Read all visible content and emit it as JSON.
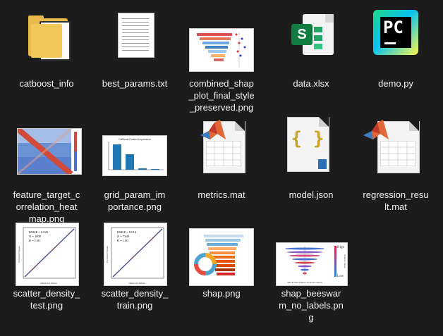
{
  "files": [
    {
      "label": "catboost_info",
      "icon": "folder-icon"
    },
    {
      "label": "best_params.txt",
      "icon": "text-file-icon"
    },
    {
      "label": "combined_shap\n_plot_final_style\n_preserved.png",
      "icon": "image-thumbnail-icon"
    },
    {
      "label": "data.xlsx",
      "icon": "excel-file-icon"
    },
    {
      "label": "demo.py",
      "icon": "pycharm-icon"
    },
    {
      "label": "feature_target_c\norrelation_heat\nmap.png",
      "icon": "image-thumbnail-icon"
    },
    {
      "label": "grid_param_im\nportance.png",
      "icon": "image-thumbnail-icon"
    },
    {
      "label": "metrics.mat",
      "icon": "matlab-file-icon"
    },
    {
      "label": "model.json",
      "icon": "json-file-icon"
    },
    {
      "label": "regression_resu\nlt.mat",
      "icon": "matlab-file-icon"
    },
    {
      "label": "scatter_density_\ntest.png",
      "icon": "image-thumbnail-icon"
    },
    {
      "label": "scatter_density_\ntrain.png",
      "icon": "image-thumbnail-icon"
    },
    {
      "label": "shap.png",
      "icon": "image-thumbnail-icon"
    },
    {
      "label": "shap_beeswar\nm_no_labels.pn\ng",
      "icon": "image-thumbnail-icon"
    }
  ],
  "thumbs": {
    "excel_letter": "S",
    "pycharm_letters": "PC",
    "json_braces": "{ }",
    "grid_title": "CatBoost Feature Importance",
    "scatter_test": {
      "rmse": "RMSE = 0.026",
      "n": "N = 1000",
      "r": "R = 1.00",
      "xlabel": "Observed Values",
      "ylabel": "Predicted Values"
    },
    "scatter_train": {
      "rmse": "RMSE = 0.014",
      "n": "N = 7200",
      "r": "R = 1.00",
      "xlabel": "Observed Values",
      "ylabel": "Predicted Values"
    },
    "beeswarm": {
      "high": "High",
      "low": "Low",
      "side": "Feature Value",
      "xlabel": "SHAP Value (impact on model output)"
    }
  },
  "colors": {
    "background": "#1c1c1c",
    "folder": "#e9b949",
    "excel": "#107c41",
    "matlab": "#e16737"
  }
}
